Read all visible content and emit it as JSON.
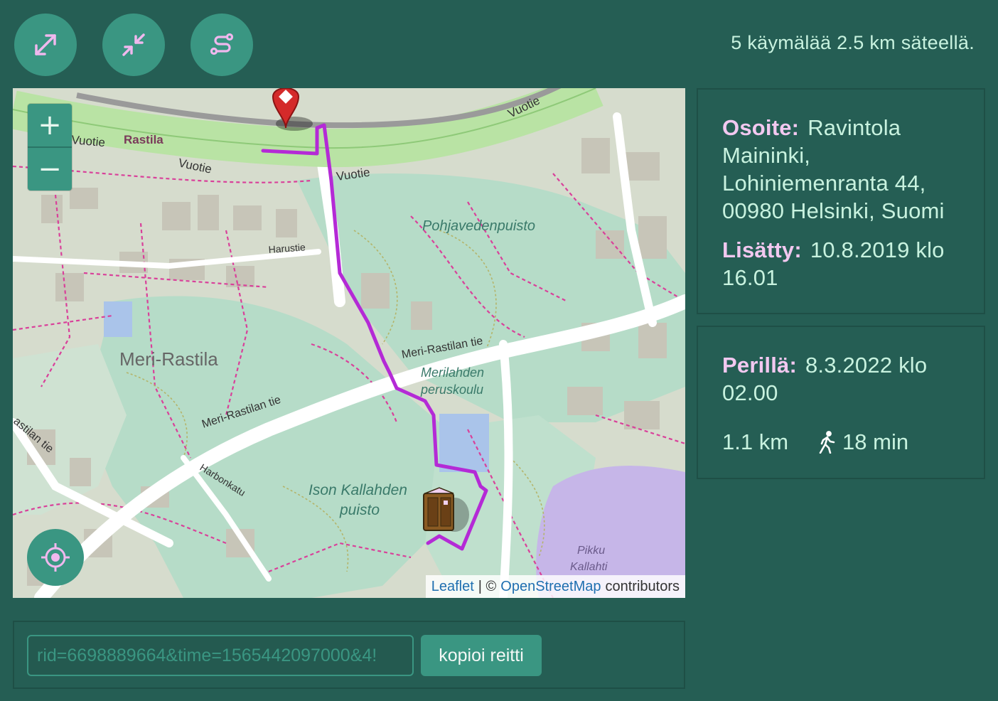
{
  "toolbar": {
    "expand_icon": "expand-arrows-icon",
    "shrink_icon": "shrink-arrows-icon",
    "route_icon": "route-icon"
  },
  "status": {
    "text": "5 käymälää 2.5 km säteellä."
  },
  "map": {
    "zoom_in_label": "+",
    "zoom_out_label": "−",
    "locate_icon": "crosshair-icon",
    "labels": {
      "rastila": "Rastila",
      "vuotie_1": "Vuotie",
      "vuotie_2": "Vuotie",
      "vuotie_3": "Vuotie",
      "vuotie_4": "Vuotie",
      "harustie": "Harustie",
      "pohjavedenpuisto": "Pohjavedenpuisto",
      "meri_rastila": "Meri-Rastila",
      "meri_rastilan_tie_1": "Meri-Rastilan tie",
      "meri_rastilan_tie_2": "Meri-Rastilan tie",
      "merilahden_1": "Merilahden",
      "merilahden_2": "peruskoulu",
      "ison_kallahden_1": "Ison Kallahden",
      "ison_kallahden_2": "puisto",
      "harbonkatu": "Harbonkatu",
      "pikku_kallahti_1": "Pikku",
      "pikku_kallahti_2": "Kallahti",
      "rastilan_tie_left": "astilan tie"
    },
    "attribution": {
      "leaflet": "Leaflet",
      "separator": "| ©",
      "osm": "OpenStreetMap",
      "contributors": "contributors"
    },
    "colors": {
      "route": "#b42ad6",
      "water": "#aad3df",
      "park": "#c8e4cc",
      "road_major": "#ffffff",
      "motorway": "#b9e3a4",
      "path": "#e03a8a"
    }
  },
  "info": {
    "address_label": "Osoite:",
    "address_lines": [
      "Ravintola",
      "Maininki,",
      "Lohiniemenranta 44,",
      "00980 Helsinki, Suomi"
    ],
    "added_label": "Lisätty:",
    "added_lines": [
      "10.8.2019 klo",
      "16.01"
    ]
  },
  "arrival": {
    "label": "Perillä:",
    "lines": [
      "8.3.2022 klo",
      "02.00"
    ],
    "distance": "1.1 km",
    "duration": "18 min",
    "walk_icon": "walking-person-icon"
  },
  "route_share": {
    "input_value": "!4&rid=6698889664&time=1565442097000",
    "copy_label": "kopioi reitti"
  }
}
